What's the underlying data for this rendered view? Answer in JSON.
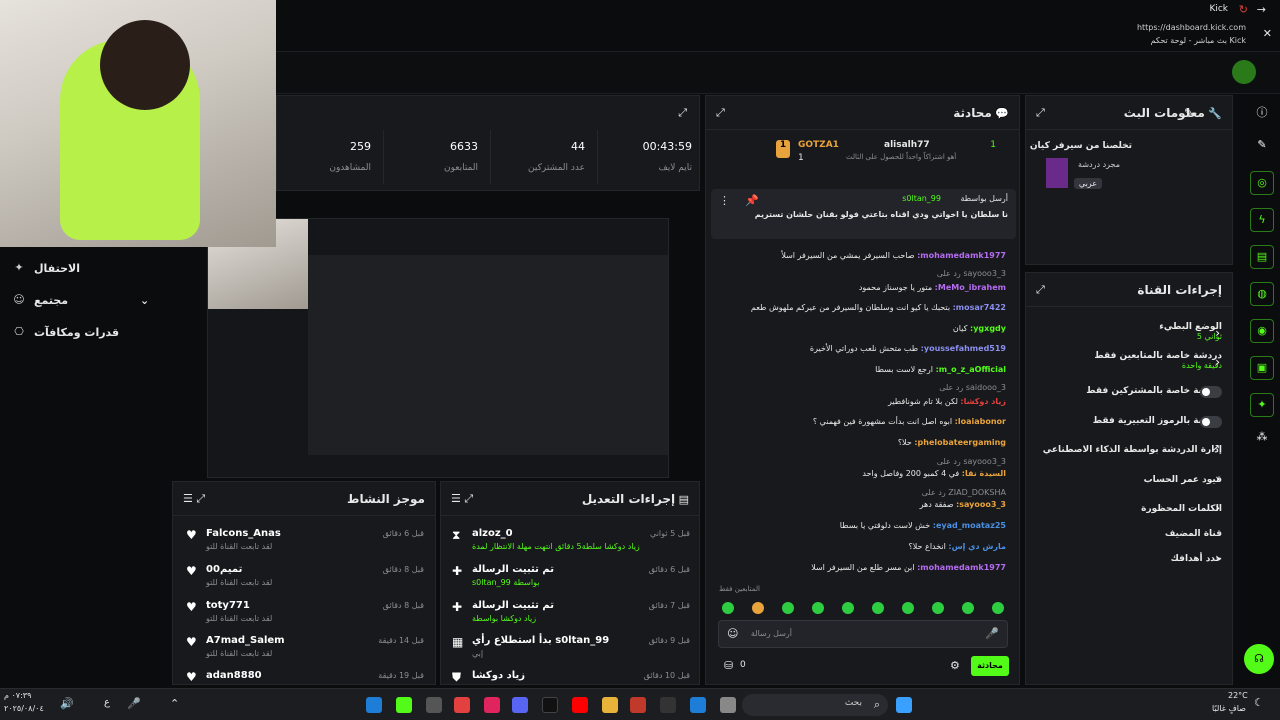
{
  "browser": {
    "app": "Kick",
    "url": "https://dashboard.kick.com",
    "tab_title": "بث مباشر - لوحة تحكم Kick"
  },
  "stats": [
    {
      "value": "259",
      "label": "المشاهدون"
    },
    {
      "value": "6633",
      "label": "المتابعون"
    },
    {
      "value": "44",
      "label": "عدد المشتركين"
    },
    {
      "value": "00:43:59",
      "label": "تايم لايف"
    }
  ],
  "sidebar": {
    "items": [
      {
        "label": "الاحتفال"
      },
      {
        "label": "مجتمع"
      },
      {
        "label": "قدرات ومكافآت"
      }
    ]
  },
  "chat": {
    "title": "محادثة",
    "top_gifter_1": "GOTZA1",
    "top_gifter_1_count": "1",
    "top_gifter_2": "alisalh77",
    "top_gifter_2_count": "1",
    "gift_note": "أهو اشتراكاً واحداً للحصول على الثالث",
    "pinned_by_label": "أرسل بواسطة",
    "pinned_by_user": "s0ltan_99",
    "pinned_message": "نا سلطان يا اخواتي ودي اقناه بتاعتي فولو بقنان حلشان تستريم",
    "messages": [
      {
        "user": "mohamedamk1977:",
        "text": "صاحب السيرفر يمشي من السيرفر اسلأ",
        "color": "#b46cf0"
      },
      {
        "user": "",
        "text": "sayooo3_3 رد على",
        "color": "#8a8d93"
      },
      {
        "user": "MeMo_ibrahem:",
        "text": "متور يا جوسناز محمود",
        "color": "#b46cf0"
      },
      {
        "user": "mosar7422:",
        "text": "بتحبك يا كيو انت وسلطان والسيرفر من عيركم ملهوش طعم",
        "color": "#8a8ff0"
      },
      {
        "user": "ygxgdy:",
        "text": "كيان",
        "color": "#53fc18"
      },
      {
        "user": "youssefahmed519:",
        "text": "طب متحش نلعب دوراتي الأخيرة",
        "color": "#8a8ff0"
      },
      {
        "user": "m_o_z_aOfficial:",
        "text": "ارجع لاست بسطا",
        "color": "#53fc18"
      },
      {
        "user": "",
        "text": "saidooo_3 رد على",
        "color": "#8a8d93"
      },
      {
        "user": "زياد دوكشا:",
        "text": "لكن بلا تام شونافطير",
        "color": "#e34040"
      },
      {
        "user": "loaiabonor:",
        "text": "ابوه اصل انت بدأت مشهورة فين فهمني ؟",
        "color": "#e8a33c"
      },
      {
        "user": "phelobateergaming:",
        "text": "حلا؟",
        "color": "#e8a33c"
      },
      {
        "user": "",
        "text": "sayooo3_3 رد على",
        "color": "#8a8d93"
      },
      {
        "user": "السيدة نقا:",
        "text": "في 4 كمبو 200 وفاصل واحد",
        "color": "#e8a33c"
      },
      {
        "user": "",
        "text": "ZIAD_DOKSHA رد على",
        "color": "#8a8d93"
      },
      {
        "user": "sayooo3_3:",
        "text": "صفقة دهر",
        "color": "#e8a33c"
      },
      {
        "user": "eyad_moataz25:",
        "text": "خش لاست دلوقتي يا بسطا",
        "color": "#4a90e2"
      },
      {
        "user": "مارش دي إس:",
        "text": "انخداع حلا؟",
        "color": "#4a90e2"
      },
      {
        "user": "mohamedamk1977:",
        "text": "ابن مسر طلع من السيرفر اسلا",
        "color": "#b46cf0"
      }
    ],
    "followers_only": "المتابعين فقط",
    "input_placeholder": "أرسل رسالة",
    "send_label": "محادثة",
    "points": "0"
  },
  "stream_info": {
    "title": "معلومات البث",
    "stream_title": "تخلصنا من سيرفر كيان",
    "category": "مجرد دردشة",
    "language": "عربي"
  },
  "channel_actions": {
    "title": "إجراءات القناة",
    "items": [
      {
        "label": "الوضع البطيء",
        "sub": "5 ثواني",
        "control": "chevron"
      },
      {
        "label": "دردشة خاصة بالمتابعين فقط",
        "sub": "دقيقة واحدة",
        "control": "chevron"
      },
      {
        "label": "دردشة خاصة بالمشتركين فقط",
        "sub": "",
        "control": "toggle"
      },
      {
        "label": "دردشة بالرموز التعبيرية فقط",
        "sub": "",
        "control": "toggle"
      },
      {
        "label": "إدارة الدردشة بواسطة الذكاء الاصطناعي",
        "sub": "",
        "control": "external"
      },
      {
        "label": "قيود عمر الحساب",
        "sub": "",
        "control": "chevron"
      },
      {
        "label": "الكلمات المحظورة",
        "sub": "",
        "control": "chevron"
      },
      {
        "label": "قناة المضيف",
        "sub": "",
        "control": "none"
      },
      {
        "label": "حدد أهدافك",
        "sub": "",
        "control": "chevron"
      }
    ]
  },
  "activity": {
    "title": "موجز النشاط",
    "items": [
      {
        "name": "Falcons_Anas",
        "sub": "لقد تابعت القناة للتو",
        "time": "قبل 6 دقائق"
      },
      {
        "name": "0تميم0",
        "sub": "لقد تابعت القناة للتو",
        "time": "قبل 8 دقائق"
      },
      {
        "name": "toty771",
        "sub": "لقد تابعت القناة للتو",
        "time": "قبل 8 دقائق"
      },
      {
        "name": "A7mad_Salem",
        "sub": "لقد تابعت القناة للتو",
        "time": "قبل 14 دقيقة"
      },
      {
        "name": "adan8880",
        "sub": "",
        "time": "قبل 19 دقيقة"
      }
    ]
  },
  "mod_actions": {
    "title": "إجراءات التعديل",
    "items": [
      {
        "name": "alzoz_0",
        "sub": "زياد دوكشا سلطة5 دقائق انتهت مهلة الانتظار لمدة",
        "time": "قبل 5 ثواني",
        "icon": "⧗"
      },
      {
        "name": "تم تثبيت الرسالة",
        "sub": "s0ltan_99 بواسطة",
        "time": "قبل 6 دقائق",
        "icon": "📌"
      },
      {
        "name": "تم تثبيت الرسالة",
        "sub": "زياد دوكشا بواسطة",
        "time": "قبل 7 دقائق",
        "icon": "📌"
      },
      {
        "name": "بدأ استطلاع رأي s0ltan_99",
        "sub": "إبي",
        "time": "قبل 9 دقائق",
        "icon": "▦"
      },
      {
        "name": "زياد دوكشا",
        "sub": "",
        "time": "قبل 10 دقائق",
        "icon": "⛊"
      }
    ]
  },
  "taskbar": {
    "search": "بحث",
    "weather_temp": "22°C",
    "weather_desc": "صافٍ غالبًا",
    "time": "٠٧:٣٩ م",
    "date": "٢٠٢٥/٠٨/٠٤",
    "lang": "ع"
  }
}
